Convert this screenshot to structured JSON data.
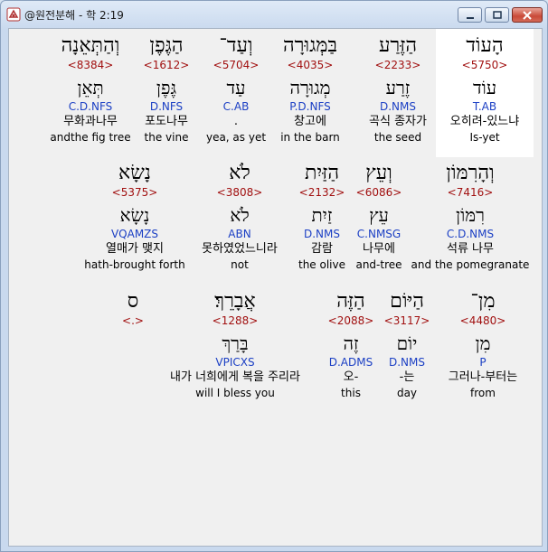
{
  "window": {
    "title": "@원전분해 - 학 2:19",
    "app_icon": "hebrew-app-icon",
    "controls": {
      "minimize": "minimize-icon",
      "maximize": "maximize-icon",
      "close": "close-icon"
    }
  },
  "rows": [
    {
      "words": [
        {
          "heb1": "הָעוֹד",
          "strong": "<5750>",
          "heb2": "עוֹד",
          "parse": "T.AB",
          "kor": "오히려-있느냐",
          "eng": "Is-yet"
        },
        {
          "heb1": "הַזֶּרַע",
          "strong": "<2233>",
          "heb2": "זֶרַע",
          "parse": "D.NMS",
          "kor": "곡식 종자가",
          "eng": "the seed"
        },
        {
          "heb1": "בַּמְּגוּרָה",
          "strong": "<4035>",
          "heb2": "מְגוּרָה",
          "parse": "P.D.NFS",
          "kor": "창고에",
          "eng": "in the barn"
        },
        {
          "heb1": "וְעַד־",
          "strong": "<5704>",
          "heb2": "עַד",
          "parse": "C.AB",
          "kor": ".",
          "eng": "yea, as yet"
        },
        {
          "heb1": "הַגֶּפֶן",
          "strong": "<1612>",
          "heb2": "גֶּפֶן",
          "parse": "D.NFS",
          "kor": "포도나무",
          "eng": "the vine"
        },
        {
          "heb1": "וְהַתְּאֵנָה",
          "strong": "<8384>",
          "heb2": "תְּאֵן",
          "parse": "C.D.NFS",
          "kor": "무화과나무",
          "eng": "andthe fig tree"
        }
      ]
    },
    {
      "words": [
        {
          "heb1": "וְהָרִמּוֹן",
          "strong": "<7416>",
          "heb2": "רִמּוֹן",
          "parse": "C.D.NMS",
          "kor": "석류 나무",
          "eng": "and the pomegranate"
        },
        {
          "heb1": "וְעֵץ",
          "strong": "<6086>",
          "heb2": "עֵץ",
          "parse": "C.NMSG",
          "kor": "나무에",
          "eng": "and-tree"
        },
        {
          "heb1": "הַזַּיִת",
          "strong": "<2132>",
          "heb2": "זַיִת",
          "parse": "D.NMS",
          "kor": "감람",
          "eng": "the olive"
        },
        {
          "heb1": "לֹא",
          "strong": "<3808>",
          "heb2": "לֹא",
          "parse": "ABN",
          "kor": "못하였었느니라",
          "eng": "not"
        },
        {
          "heb1": "נָשָׂא",
          "strong": "<5375>",
          "heb2": "נָשָׂא",
          "parse": "VQAMZS",
          "kor": "열매가 맺지",
          "eng": "hath-brought forth"
        }
      ]
    },
    {
      "words": [
        {
          "heb1": "מִן־",
          "strong": "<4480>",
          "heb2": "מִן",
          "parse": "P",
          "kor": "그러나-부터는",
          "eng": "from"
        },
        {
          "heb1": "הַיּוֹם",
          "strong": "<3117>",
          "heb2": "יוֹם",
          "parse": "D.NMS",
          "kor": "-는",
          "eng": "day"
        },
        {
          "heb1": "הַזֶּה",
          "strong": "<2088>",
          "heb2": "זֶה",
          "parse": "D.ADMS",
          "kor": "오-",
          "eng": "this"
        },
        {
          "heb1": "אֲבָרֵךְ׃",
          "strong": "<1288>",
          "heb2": "בָּרַךְ",
          "parse": "VPICXS",
          "kor": "내가 너희에게 복을 주리라",
          "eng": "will I bless you"
        },
        {
          "heb1": "ס",
          "strong": "<.>",
          "heb2": "",
          "parse": "",
          "kor": "",
          "eng": ""
        }
      ]
    }
  ]
}
